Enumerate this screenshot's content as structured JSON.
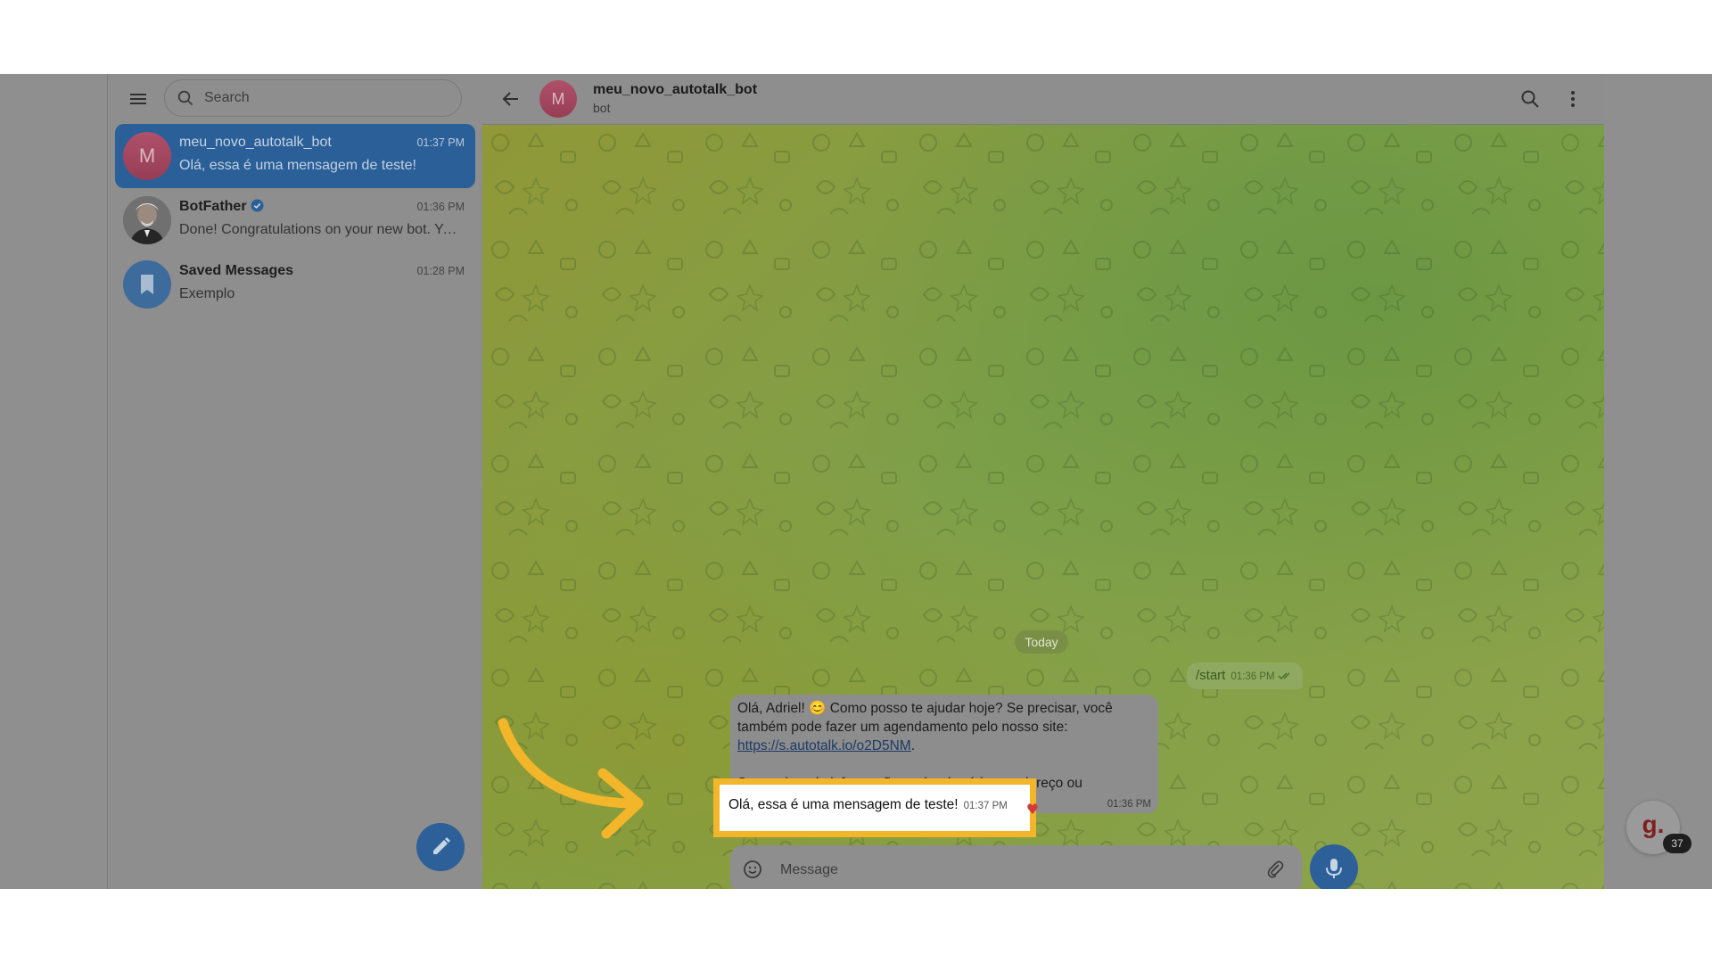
{
  "sidebar": {
    "search_placeholder": "Search",
    "chats": [
      {
        "name": "meu_novo_autotalk_bot",
        "avatar_letter": "M",
        "time": "01:37 PM",
        "preview": "Olá, essa é uma mensagem de teste!",
        "active": true
      },
      {
        "name": "BotFather",
        "verified": true,
        "time": "01:36 PM",
        "preview": "Done! Congratulations on your new bot. You will find it at t.me/meu_novo_autotalk_bot."
      },
      {
        "name": "Saved Messages",
        "time": "01:28 PM",
        "preview": "Exemplo"
      }
    ]
  },
  "chat": {
    "avatar_letter": "M",
    "name": "meu_novo_autotalk_bot",
    "status": "bot",
    "date_divider": "Today",
    "outgoing": {
      "text": "/start",
      "time": "01:36 PM"
    },
    "bot_message": {
      "line1": "Olá, Adriel! 😊 Como posso te ajudar hoje? Se precisar, você também pode fazer um agendamento pelo nosso site:",
      "link": "https://s.autotalk.io/o2D5NM",
      "link_suffix": ".",
      "line2": "Se precisar de informações sobre horários, endereço ou agendamentos, estou aqui para ajudar!",
      "time": "01:36 PM"
    },
    "test_message": {
      "text": "Olá, essa é uma mensagem de teste!",
      "time": "01:37 PM"
    },
    "composer_placeholder": "Message"
  },
  "widget": {
    "logo": "g.",
    "badge": "37"
  },
  "colors": {
    "highlight": "#f3b529",
    "accent": "#2d5f98"
  }
}
